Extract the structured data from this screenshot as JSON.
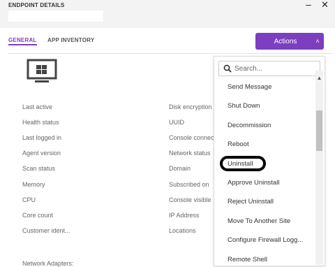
{
  "header": {
    "title": "ENDPOINT DETAILS",
    "minimize_glyph": "–",
    "close_glyph": "✕"
  },
  "tabs": [
    {
      "label": "GENERAL",
      "active": true
    },
    {
      "label": "APP INVENTORY",
      "active": false
    }
  ],
  "actions_button": {
    "label": "Actions",
    "caret": "˄"
  },
  "device_icon": "windows-monitor-icon",
  "details": {
    "left": [
      "Last active",
      "Health status",
      "Last logged in",
      "Agent version",
      "Scan status",
      "Memory",
      "CPU",
      "Core count",
      "Customer ident..."
    ],
    "right": [
      "Disk encryption",
      "UUID",
      "Console connec",
      "Network status",
      "Domain",
      "Subscribed on",
      "Console visible",
      "IP Address",
      "Locations"
    ]
  },
  "network_adapters_label": "Network Adapters:",
  "actions_menu": {
    "search_placeholder": "Search...",
    "items": [
      "Send Message",
      "Shut Down",
      "Decommission",
      "Reboot",
      "Uninstall",
      "Approve Uninstall",
      "Reject Uninstall",
      "Move To Another Site",
      "Configure Firewall Logg...",
      "Remote Shell"
    ],
    "highlighted_item": "Uninstall"
  },
  "colors": {
    "accent": "#7b3fbf",
    "header_bg": "#f3f3f3",
    "highlight_ring": "#000000"
  }
}
